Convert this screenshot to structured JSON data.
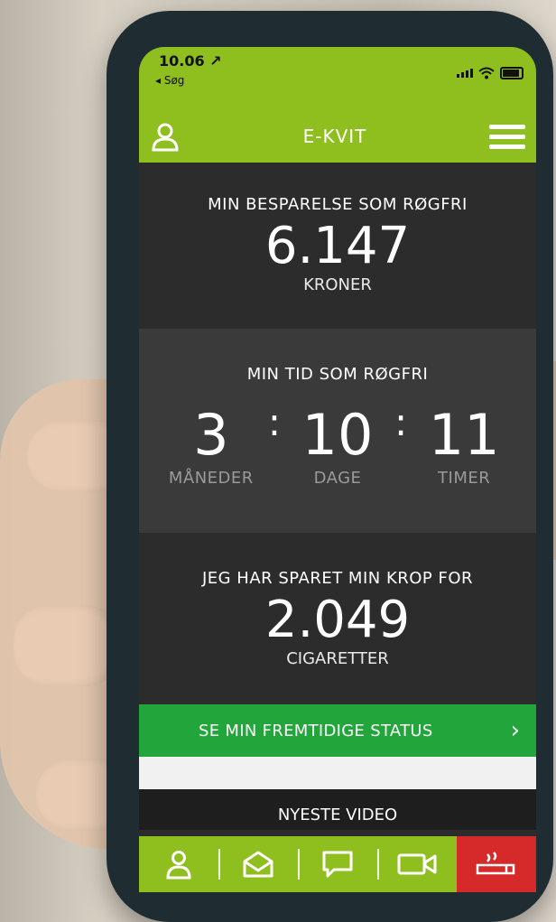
{
  "status": {
    "time": "10.06 ↗",
    "back_label": "◂ Søg"
  },
  "app": {
    "title": "E-KVIT",
    "colors": {
      "accent": "#8fbe1f",
      "cta": "#22a53a",
      "danger": "#d62a2a"
    }
  },
  "savings": {
    "title": "MIN BESPARELSE SOM RØGFRI",
    "value": "6.147",
    "unit": "KRONER"
  },
  "smoke_free_time": {
    "title": "MIN TID SOM RØGFRI",
    "months": {
      "value": "3",
      "label": "MÅNEDER"
    },
    "days": {
      "value": "10",
      "label": "DAGE"
    },
    "hours": {
      "value": "11",
      "label": "TIMER"
    },
    "separator": ":"
  },
  "cigarettes": {
    "title": "JEG HAR SPARET MIN KROP FOR",
    "value": "2.049",
    "unit": "CIGARETTER"
  },
  "cta": {
    "label": "SE MIN FREMTIDIGE STATUS",
    "arrow": "›"
  },
  "video": {
    "title": "NYESTE VIDEO"
  },
  "bottom_nav": {
    "icons": [
      "user-icon",
      "envelope-icon",
      "chat-icon",
      "video-camera-icon",
      "no-smoking-icon"
    ]
  }
}
